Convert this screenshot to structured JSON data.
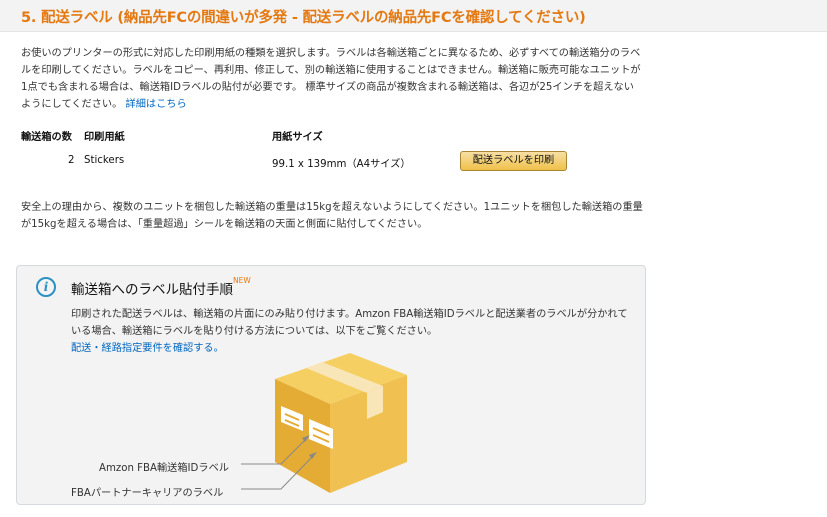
{
  "header": {
    "title": "5. 配送ラベル (納品先FCの間違いが多発 - 配送ラベルの納品先FCを確認してください)"
  },
  "intro": {
    "text": "お使いのプリンターの形式に対応した印刷用紙の種類を選択します。ラベルは各輸送箱ごとに異なるため、必ずすべての輸送箱分のラベルを印刷してください。ラベルをコピー、再利用、修正して、別の輸送箱に使用することはできません。輸送箱に販売可能なユニットが1点でも含まれる場合は、輸送箱IDラベルの貼付が必要です。 標準サイズの商品が複数含まれる輸送箱は、各辺が25インチを超えないようにしてください。",
    "link": "詳細はこちら"
  },
  "table": {
    "headers": [
      "輸送箱の数",
      "印刷用紙",
      "用紙サイズ"
    ],
    "row": {
      "count": "2",
      "paper": "Stickers",
      "size": "99.1 x 139mm（A4サイズ）"
    },
    "print_button": "配送ラベルを印刷"
  },
  "weight_notice": "安全上の理由から、複数のユニットを梱包した輸送箱の重量は15kgを超えないようにしてください。1ユニットを梱包した輸送箱の重量が15kgを超える場合は、「重量超過」シールを輸送箱の天面と側面に貼付してください。",
  "info_box": {
    "icon": "info-icon",
    "title": "輸送箱へのラベル貼付手順",
    "badge": "NEW",
    "text": "印刷された配送ラベルは、輸送箱の片面にのみ貼り付けます。Amzon FBA輸送箱IDラベルと配送業者のラベルが分かれている場合、輸送箱にラベルを貼り付ける方法については、以下をご覧ください。",
    "link": "配送・経路指定要件を確認する。",
    "label1": "Amzon FBA輸送箱IDラベル",
    "label2": "FBAパートナーキャリアのラベル"
  },
  "colors": {
    "accent_orange": "#e47911",
    "link_blue": "#0066c0",
    "info_blue": "#2b90c4",
    "box_yellow": "#f0c050",
    "button_gold": "#f0c14b"
  }
}
